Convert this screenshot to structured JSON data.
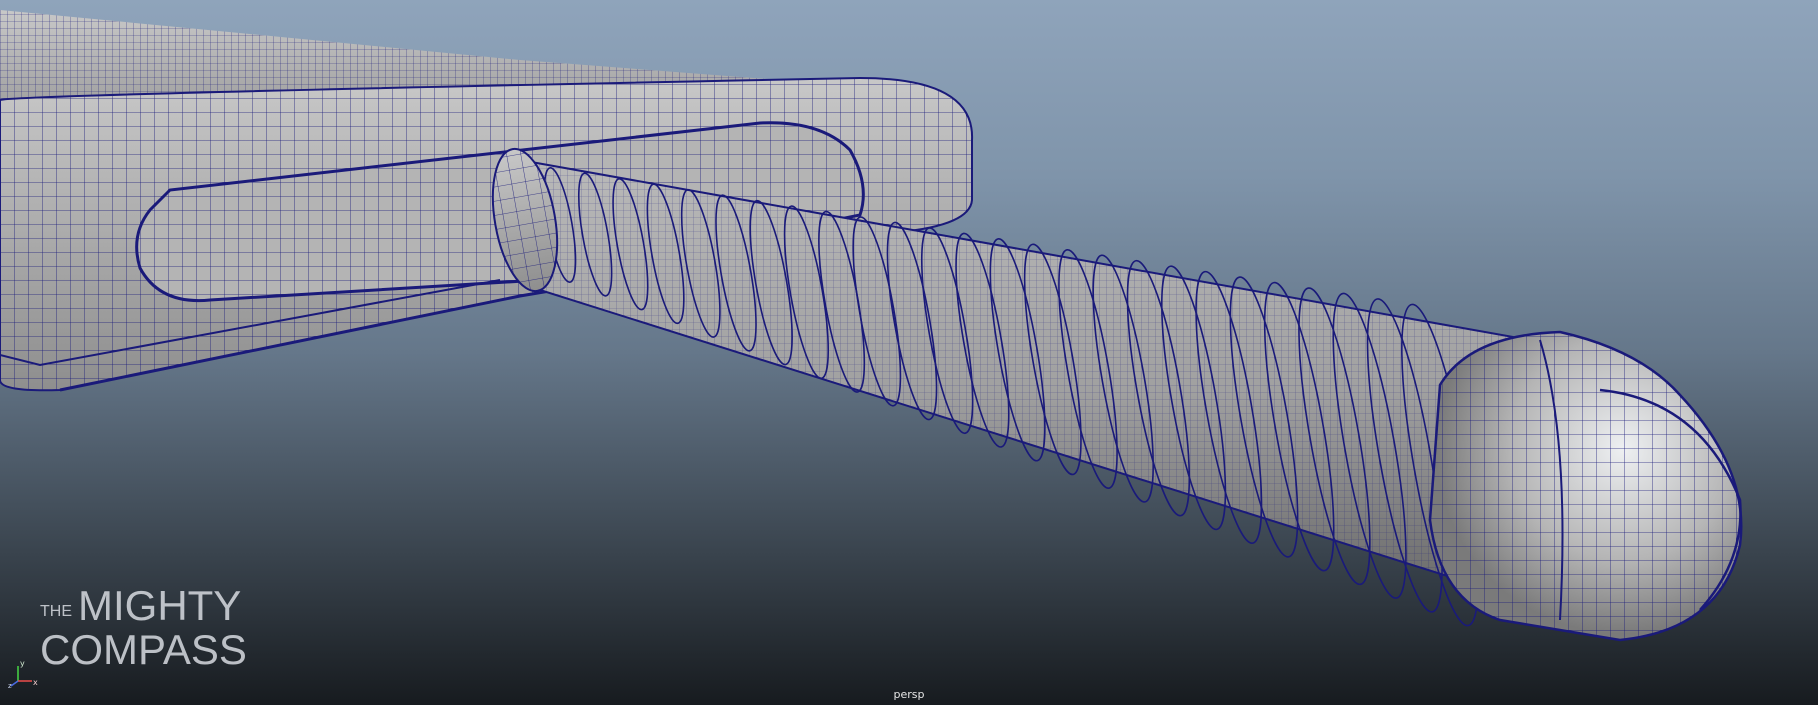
{
  "viewport": {
    "camera_label": "persp",
    "background_top": "#8fa4bb",
    "background_bottom": "#171b1f",
    "wireframe_color": "#1a1a7a",
    "surface_color": "#a6a6a6"
  },
  "watermark": {
    "line1_prefix": "THE",
    "line1": "MIGHTY",
    "line2": "COMPASS"
  },
  "axis_gizmo": {
    "x": "x",
    "y": "y",
    "z": "z"
  }
}
